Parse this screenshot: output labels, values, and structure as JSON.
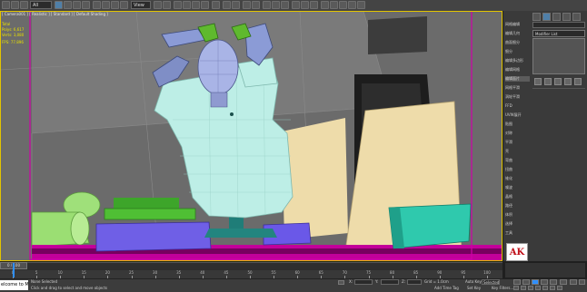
{
  "toolbar": {
    "filter_select": "All",
    "view_select": "View"
  },
  "viewport": {
    "label": "[ Camera001 ] [ Realistic ] [ Standard ] [ Default Shading ]",
    "stats": {
      "total_label": "Total",
      "polys_label": "Polys:",
      "polys_value": "6,617",
      "verts_label": "Verts:",
      "verts_value": "3,080",
      "fps_label": "FPS:",
      "fps_value": "77.896"
    }
  },
  "command_panel": {
    "modifier_list": "Modifier List",
    "side_items": [
      "网格编辑",
      "编辑几何",
      "曲面细分",
      "细分",
      "编辑多边形",
      "编辑网格",
      "编辑面片",
      "网格平滑",
      "涡轮平滑",
      "FFD",
      "UVW展开",
      "贴图",
      "对称",
      "平滑",
      "壳",
      "弯曲",
      "扭曲",
      "锥化",
      "噪波",
      "晶格",
      "路径",
      "体积",
      "选择",
      "工具"
    ],
    "selected_index": 6
  },
  "timeline": {
    "slider_text": "0 / 100",
    "ticks": [
      "0",
      "5",
      "10",
      "15",
      "20",
      "25",
      "30",
      "35",
      "40",
      "45",
      "50",
      "55",
      "60",
      "65",
      "70",
      "75",
      "80",
      "85",
      "90",
      "95",
      "100"
    ]
  },
  "status": {
    "maxscript": "elcome to MAX",
    "none_selected": "None Selected",
    "prompt": "Click and drag to select and move objects",
    "x_label": "X:",
    "y_label": "Y:",
    "z_label": "Z:",
    "grid": "Grid = 1.0cm",
    "add_time_tag": "Add Time Tag",
    "autokey": "Auto Key",
    "autokey_value": "Selected",
    "set_key": "Set Key",
    "key_filters": "Key Filters..."
  },
  "logo_text": "AK",
  "colors": {
    "viewport_bg": "#6d6d6d",
    "accent_blue": "#2f8fff",
    "stats_yellow": "#e8e000",
    "pink_floor": "#c2009a",
    "magenta_frame": "#d000a8"
  }
}
